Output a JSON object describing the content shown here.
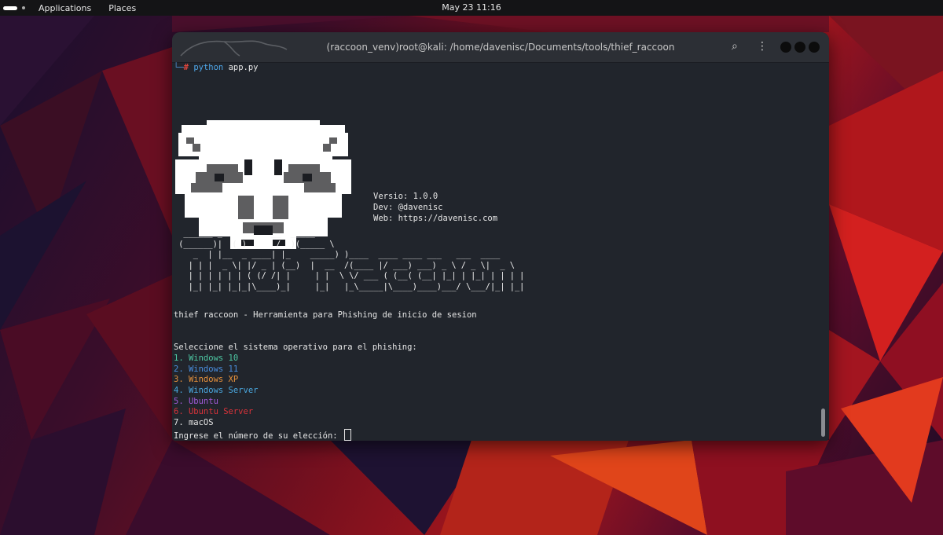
{
  "topbar": {
    "applications": "Applications",
    "places": "Places",
    "clock": "May 23  11:16"
  },
  "terminal": {
    "title": "(raccoon_venv)root@kali: /home/davenisc/Documents/tools/thief_raccoon",
    "prompt_corner": "└─",
    "prompt_hash": "#",
    "command_python": "python",
    "command_file": "app.py",
    "info": {
      "version": "Versio: 1.0.0",
      "dev": "Dev: @davenisc",
      "web": "Web: https://davenisc.com"
    },
    "ascii_banner": "  ______ _          __  _____\n (______)|  (_)      / _)(_____ \\\n    _  | |__  _ ____| |_    _____) )____  ____ ____ ___   ___  ____\n   | | |  _ \\| |/ _ | (__)  |  __  /(____ |/ ___) ___) _ \\ / _ \\|  _ \\\n   | | | | | | ( (/ /| |     | |  \\ \\/ ___ ( (__( (__| |_| | |_| | | | |\n   |_| |_| |_|_|\\____)_|     |_|   |_\\_____|\\____)____)___/ \\___/|_| |_|",
    "tagline": "thief raccoon - Herramienta para Phishing de inicio de sesion",
    "select_prompt": "Seleccione el sistema operativo para el phishing:",
    "options": [
      {
        "text": "1. Windows 10",
        "color": "#4ec9a4"
      },
      {
        "text": "2. Windows 11",
        "color": "#4a8fe0"
      },
      {
        "text": "3. Windows XP",
        "color": "#e8923c"
      },
      {
        "text": "4. Windows Server",
        "color": "#4aa8e0"
      },
      {
        "text": "5. Ubuntu",
        "color": "#a159d8"
      },
      {
        "text": "6. Ubuntu Server",
        "color": "#d8333a"
      },
      {
        "text": "7. macOS",
        "color": "#e6e6e6"
      }
    ],
    "input_prompt": "Ingrese el número de su elección:"
  },
  "colors": {
    "terminal_bg": "#21252c",
    "titlebar_bg": "#2c2f35",
    "topbar_bg": "#141416"
  }
}
